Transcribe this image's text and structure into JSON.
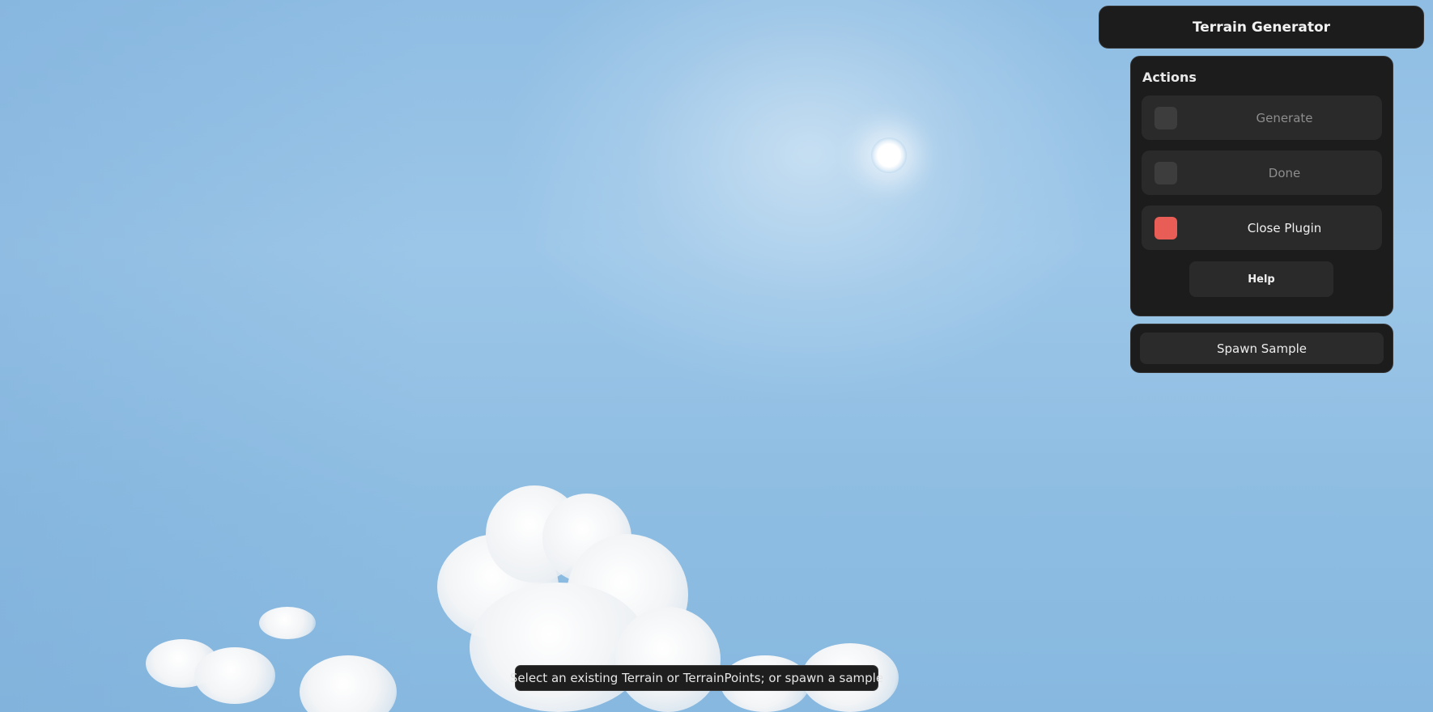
{
  "title_bar": {
    "title": "Terrain Generator"
  },
  "actions_panel": {
    "heading": "Actions",
    "items": [
      {
        "label": "Generate",
        "state": "disabled",
        "swatch_color": "#3d3d3d"
      },
      {
        "label": "Done",
        "state": "disabled",
        "swatch_color": "#3d3d3d"
      },
      {
        "label": "Close Plugin",
        "state": "enabled",
        "swatch_color": "#e85d55"
      }
    ],
    "help_label": "Help"
  },
  "spawn_panel": {
    "button_label": "Spawn Sample"
  },
  "status": {
    "message": "Select an existing Terrain or TerrainPoints; or spawn a sample"
  },
  "colors": {
    "panel_bg": "#1c1c1c",
    "row_bg": "#2a2a2a",
    "accent_red": "#e85d55",
    "sky": "#8fbde3"
  },
  "icons": {
    "sun": "sun-icon"
  }
}
